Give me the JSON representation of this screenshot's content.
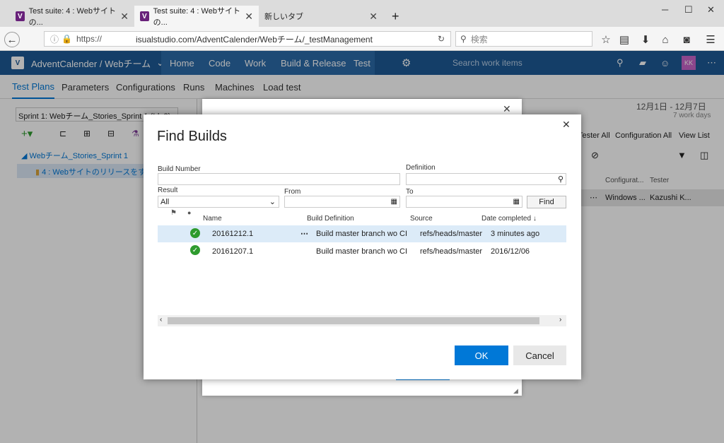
{
  "browser": {
    "tabs": [
      {
        "label": "Test suite: 4 : Webサイトの..."
      },
      {
        "label": "Test suite: 4 : Webサイトの..."
      },
      {
        "label": "新しいタブ"
      }
    ],
    "new_tab": "+",
    "url_prefix": "https://",
    "url_main": "isualstudio.com/AdventCalender/Webチーム/_testManagement",
    "search_placeholder": "検索"
  },
  "vsts": {
    "project": "AdventCalender / Webチーム",
    "nav": [
      "Home",
      "Code",
      "Work",
      "Build & Release",
      "Test"
    ],
    "search_placeholder": "Search work items",
    "avatar": "KK"
  },
  "subtabs": [
    "Test Plans",
    "Parameters",
    "Configurations",
    "Runs",
    "Machines",
    "Load test"
  ],
  "left": {
    "sprint": "Sprint 1: Webチーム_Stories_Sprint 1 (Id: 2)",
    "tree_root": "Webチーム_Stories_Sprint 1",
    "tree_child": "4 : Webサイトのリリースをする (1)"
  },
  "right": {
    "date_range": "12月1日 - 12月7日",
    "work_days": "7 work days",
    "tester_label": "Tester",
    "tester_val": "All",
    "config_label": "Configuration",
    "config_val": "All",
    "view_label": "View",
    "view_val": "List",
    "col_config": "Configurat...",
    "col_tester": "Tester",
    "row_config": "Windows ...",
    "row_tester": "Kazushi K..."
  },
  "dialog": {
    "title": "Find Builds",
    "build_number_label": "Build Number",
    "build_number_value": "",
    "definition_label": "Definition",
    "definition_value": "",
    "result_label": "Result",
    "result_value": "All",
    "from_label": "From",
    "from_value": "",
    "to_label": "To",
    "to_value": "",
    "find_label": "Find",
    "columns": [
      "Name",
      "Build Definition",
      "Source",
      "Date completed"
    ],
    "rows": [
      {
        "name": "20161212.1",
        "definition": "Build master branch wo CI",
        "source": "refs/heads/master",
        "date": "3 minutes ago"
      },
      {
        "name": "20161207.1",
        "definition": "Build master branch wo CI",
        "source": "refs/heads/master",
        "date": "2016/12/06"
      }
    ],
    "ok_label": "OK",
    "cancel_label": "Cancel"
  },
  "colors": {
    "accent": "#0078d7",
    "header": "#1e5a96",
    "success": "#2e9b2e"
  }
}
